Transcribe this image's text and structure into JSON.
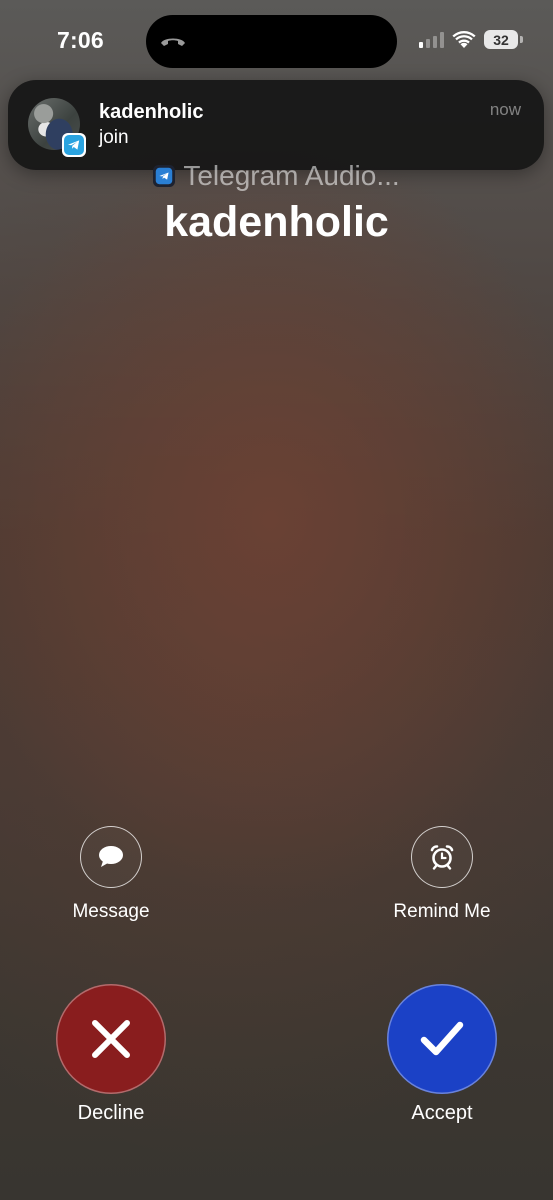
{
  "status_bar": {
    "time": "7:06",
    "battery": "32",
    "signal_bars_on": 1,
    "signal_bars_total": 4
  },
  "notification": {
    "title": "kadenholic",
    "body": "join",
    "time": "now",
    "app_icon": "telegram-icon"
  },
  "call": {
    "subtitle": "Telegram Audio...",
    "name": "kadenholic"
  },
  "actions": {
    "message_label": "Message",
    "remind_label": "Remind Me",
    "decline_label": "Decline",
    "accept_label": "Accept"
  },
  "colors": {
    "decline": "#891d1e",
    "accept": "#1b41c6",
    "telegram": "#2aa3e0"
  }
}
